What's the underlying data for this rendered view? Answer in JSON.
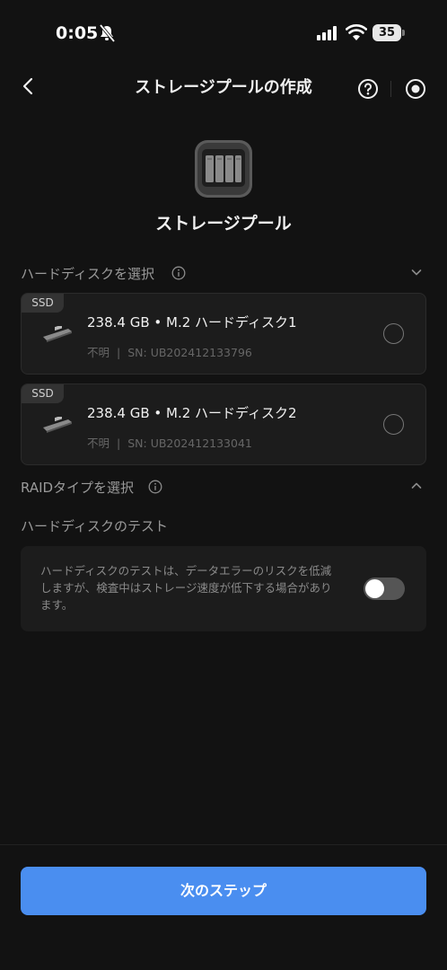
{
  "status_bar": {
    "time": "0:05",
    "battery": "35"
  },
  "header": {
    "title": "ストレージプールの作成"
  },
  "pool": {
    "title": "ストレージプール"
  },
  "disk_section": {
    "title": "ハードディスクを選択"
  },
  "disks": [
    {
      "badge": "SSD",
      "name": "238.4 GB • M.2 ハードディスク1",
      "status": "不明",
      "separator": "|",
      "serial": "SN: UB202412133796"
    },
    {
      "badge": "SSD",
      "name": "238.4 GB • M.2 ハードディスク2",
      "status": "不明",
      "separator": "|",
      "serial": "SN: UB202412133041"
    }
  ],
  "raid_section": {
    "title": "RAIDタイプを選択"
  },
  "disk_test": {
    "title": "ハードディスクのテスト",
    "description": "ハードディスクのテストは、データエラーのリスクを低減しますが、検査中はストレージ速度が低下する場合があります。",
    "enabled": false
  },
  "footer": {
    "next_label": "次のステップ"
  },
  "colors": {
    "accent": "#4a8ef0",
    "background": "#121212",
    "card": "#1c1c1c"
  }
}
